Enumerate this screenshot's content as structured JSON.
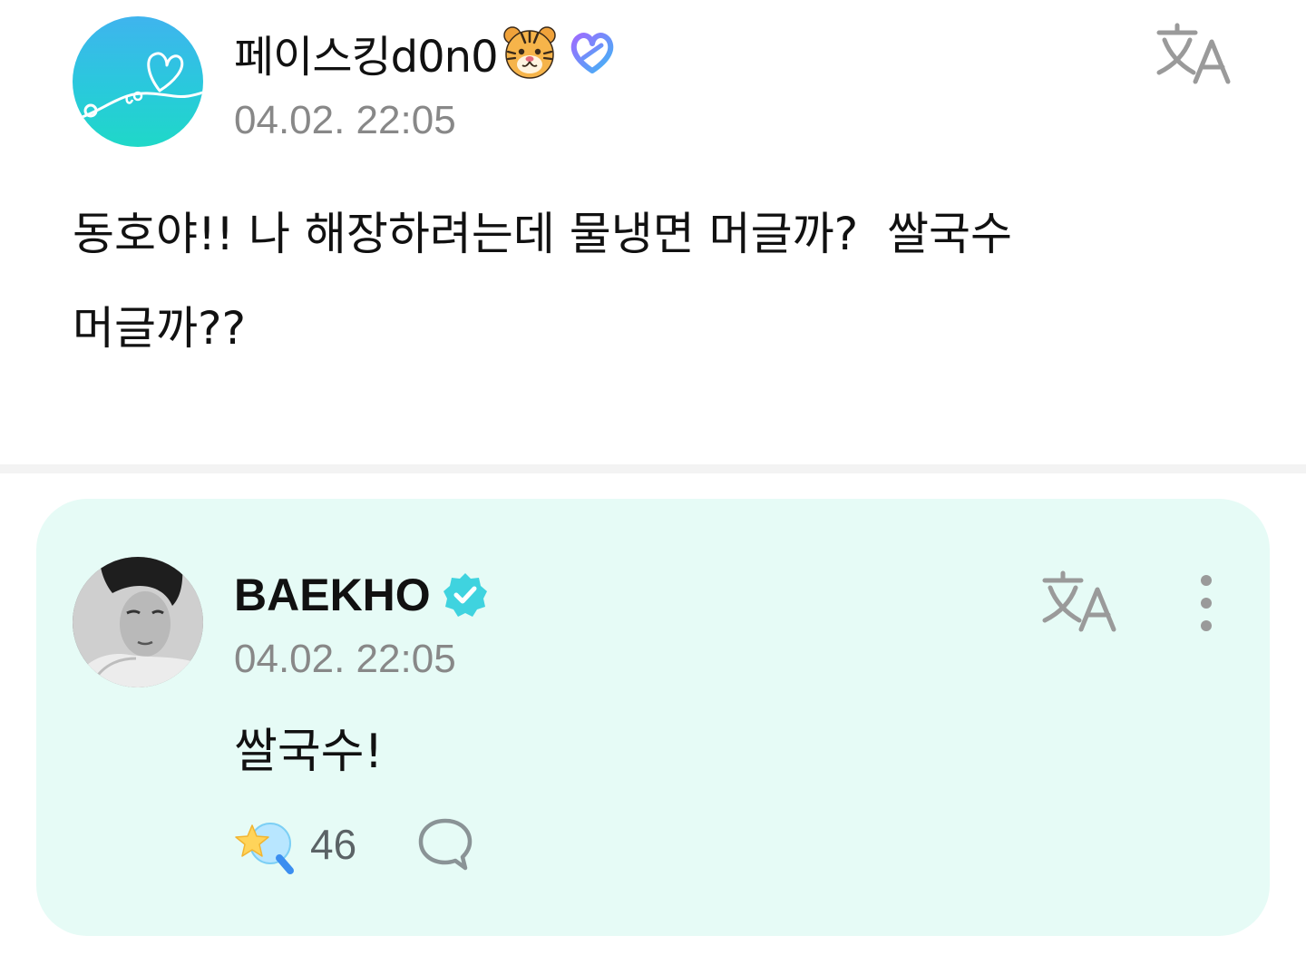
{
  "post": {
    "author": "페이스킹d0n0",
    "author_emoji": "tiger-face-icon",
    "membership_badge": "membership-heart-icon",
    "timestamp": "04.02. 22:05",
    "body": "동호야!! 나 해장하려는데 물냉면 머글까?  쌀국수\n머글까??",
    "translate_icon": "translate-icon"
  },
  "comment": {
    "author": "BAEKHO",
    "verified_icon": "verified-check-icon",
    "timestamp": "04.02. 22:05",
    "body": "쌀국수!",
    "translate_icon": "translate-icon",
    "more_icon": "more-vertical-icon",
    "reactions": {
      "icon": "star-wand-icon",
      "count": "46"
    },
    "reply_icon": "speech-bubble-icon"
  },
  "colors": {
    "card_background": "#e6fbf6",
    "verified_badge": "#3fd3df",
    "timestamp_gray": "#888888",
    "icon_gray": "#9a9a9a",
    "divider": "#f3f3f3"
  }
}
